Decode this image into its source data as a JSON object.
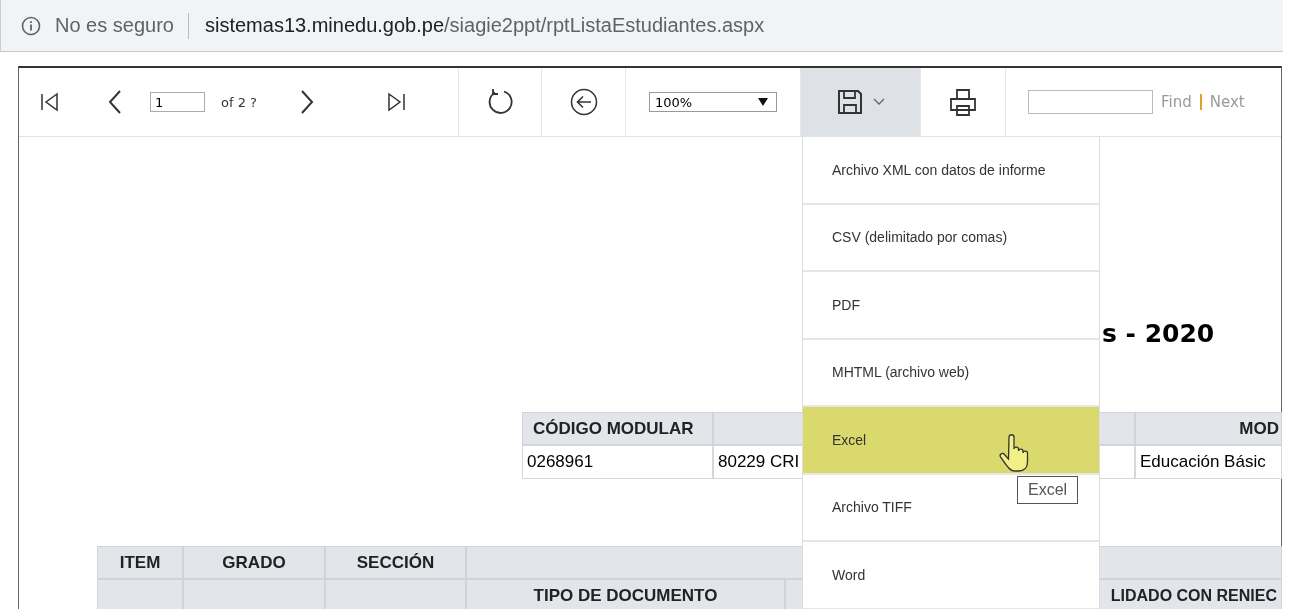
{
  "address_bar": {
    "security": "No es seguro",
    "host": "sistemas13.minedu.gob.pe",
    "path": "/siagie2ppt/rptListaEstudiantes.aspx"
  },
  "toolbar": {
    "page": "1",
    "page_count": "of 2 ?",
    "zoom": "100%",
    "find": "Find",
    "next": "Next"
  },
  "export_menu": {
    "open": true,
    "tooltip": "Excel",
    "items": [
      {
        "label": "Archivo XML con datos de informe",
        "selected": false
      },
      {
        "label": "CSV (delimitado por comas)",
        "selected": false
      },
      {
        "label": "PDF",
        "selected": false
      },
      {
        "label": "MHTML (archivo web)",
        "selected": false
      },
      {
        "label": "Excel",
        "selected": true
      },
      {
        "label": "Archivo TIFF",
        "selected": false
      },
      {
        "label": "Word",
        "selected": false
      }
    ]
  },
  "report": {
    "title": "s - 2020",
    "info_table": {
      "columns": [
        {
          "header": "CÓDIGO MODULAR",
          "value": "0268961"
        },
        {
          "value": "80229 CRI"
        },
        {
          "header": "MOD",
          "value": "Educación Básic"
        }
      ]
    },
    "student_table": {
      "header_row_1": [
        "ITEM",
        "GRADO",
        "SECCIÓN"
      ],
      "header_row_2": [
        "TIPO DE DOCUMENTO",
        "LIDADO CON RENIEC"
      ]
    }
  }
}
